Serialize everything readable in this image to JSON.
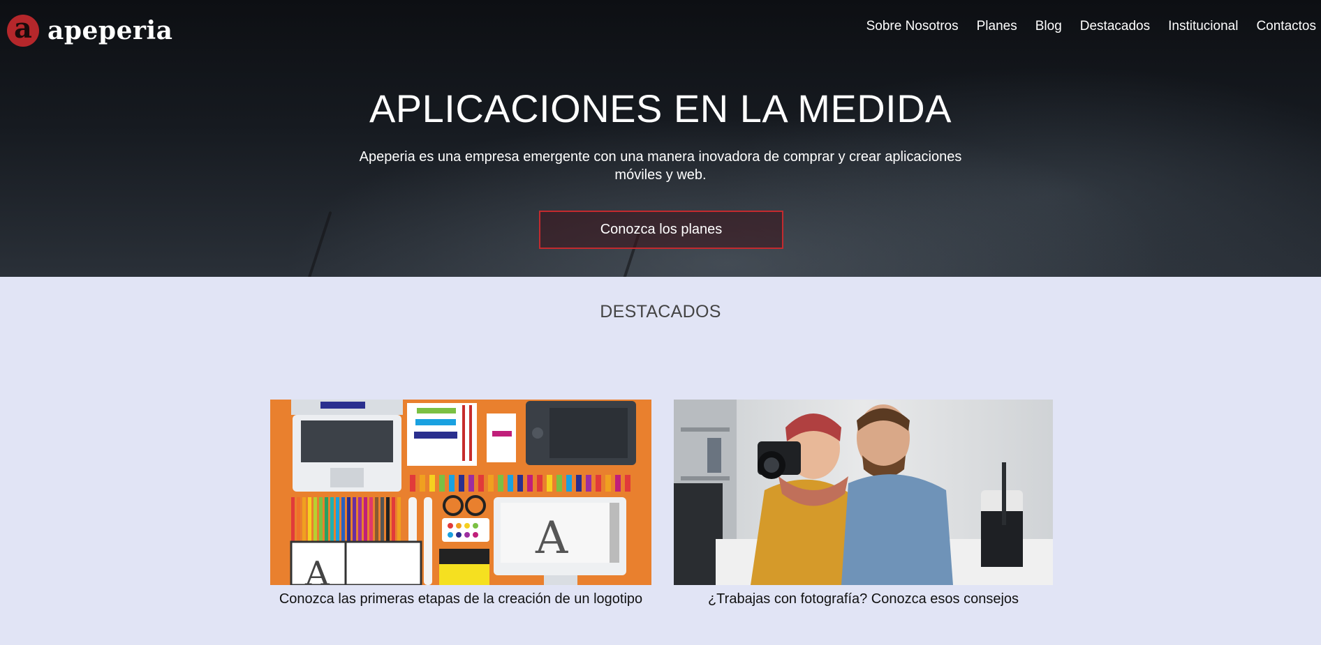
{
  "brand": {
    "logo_letter": "a",
    "name": "apeperia"
  },
  "nav": {
    "items": [
      {
        "label": "Sobre Nosotros"
      },
      {
        "label": "Planes"
      },
      {
        "label": "Blog"
      },
      {
        "label": "Destacados"
      },
      {
        "label": "Institucional"
      },
      {
        "label": "Contactos"
      }
    ]
  },
  "hero": {
    "title": "APLICACIONES EN LA MEDIDA",
    "subtitle": "Apeperia es una empresa emergente con una manera inovadora de comprar y crear aplicaciones móviles y web.",
    "cta_label": "Conozca los planes"
  },
  "featured": {
    "title": "DESTACADOS",
    "cards": [
      {
        "caption": "Conozca las primeras etapas de la creación de un logotipo",
        "image": "designer-desk-illustration"
      },
      {
        "caption": "¿Trabajas con fotografía? Conozca esos consejos",
        "image": "photographers-photo"
      }
    ]
  },
  "colors": {
    "accent": "#c32a2e",
    "section_bg": "#e1e4f5",
    "hero_bg": "#161a20",
    "orange": "#e9802e"
  }
}
